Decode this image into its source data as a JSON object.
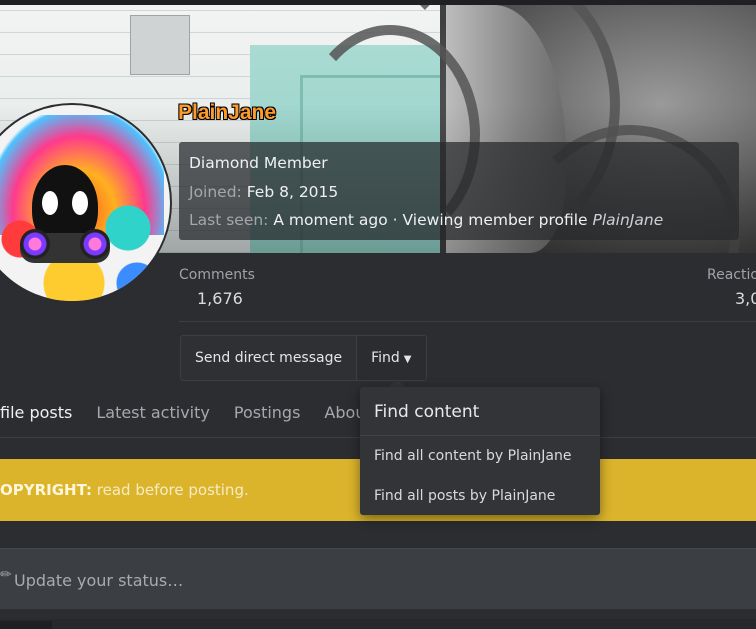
{
  "profile": {
    "username": "PlainJane",
    "rank": "Diamond Member",
    "joined_label": "Joined:",
    "joined_date": "Feb 8, 2015",
    "last_seen_label": "Last seen:",
    "last_seen_value": "A moment ago · Viewing member profile",
    "last_seen_target": "PlainJane"
  },
  "stats": [
    {
      "label": "Comments",
      "value": "1,676"
    },
    {
      "label": "Reactio",
      "value": "3,0"
    }
  ],
  "actions": {
    "send_message": "Send direct message",
    "find": "Find"
  },
  "tabs": [
    {
      "label": "file posts",
      "active": true
    },
    {
      "label": "Latest activity"
    },
    {
      "label": "Postings"
    },
    {
      "label": "Abou"
    }
  ],
  "notice": {
    "strong": "OPYRIGHT:",
    "text": " read before posting."
  },
  "status": {
    "placeholder": "Update your status…"
  },
  "find_menu": {
    "title": "Find content",
    "items": [
      "Find all content by PlainJane",
      "Find all posts by PlainJane"
    ]
  },
  "colors": {
    "background": "#2b2d31",
    "username": "#ff9a2a",
    "notice": "#dcb42b",
    "dropdown": "#323438"
  }
}
